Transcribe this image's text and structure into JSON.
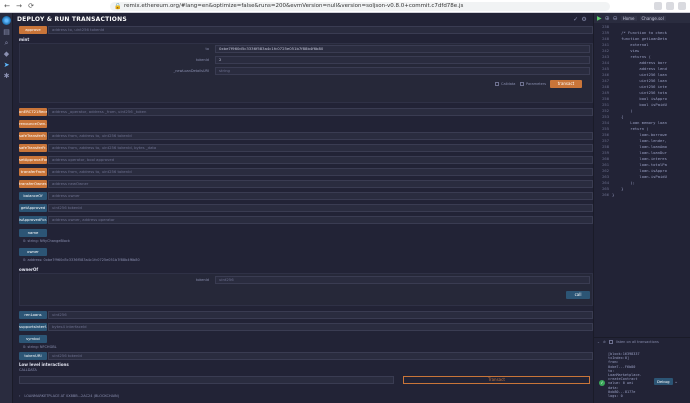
{
  "browser": {
    "url": "remix.ethereum.org/#lang=en&optimize=false&runs=200&evmVersion=null&version=soljson-v0.8.0+commit.c7dfd78e.js",
    "nav": [
      "←",
      "→",
      "⟳"
    ],
    "lock": "🔒"
  },
  "panel": {
    "title": "DEPLOY & RUN TRANSACTIONS",
    "icons": [
      "✓",
      "⚙"
    ]
  },
  "top_fn": {
    "label": "approve",
    "placeholder": "address to, uint256 tokenId"
  },
  "mint_section": {
    "title": "mint",
    "fields": [
      {
        "label": "to",
        "value": "0xbe7f960d5c3336f583a4c1fc0725e051b7f88b4f6b80"
      },
      {
        "label": "tokenId",
        "value": "2"
      },
      {
        "label": "_newLoanDetailsURI",
        "value": "string"
      }
    ],
    "calldata_label": "Calldata",
    "parameters_label": "Parameters",
    "transact_label": "transact"
  },
  "write_functions": [
    {
      "label": "onERC721Recei...",
      "placeholder": "address _operator, address _from, uint256 _token",
      "color": "orange"
    },
    {
      "label": "renounceOwn...",
      "placeholder": "",
      "color": "orange"
    },
    {
      "label": "safeTransferFr...",
      "placeholder": "address from, address to, uint256 tokenId",
      "color": "orange"
    },
    {
      "label": "safeTransferFr...",
      "placeholder": "address from, address to, uint256 tokenId, bytes _data",
      "color": "orange"
    },
    {
      "label": "setApprovalFor...",
      "placeholder": "address operator, bool approved",
      "color": "orange"
    },
    {
      "label": "transferFrom",
      "placeholder": "address from, address to, uint256 tokenId",
      "color": "orange"
    },
    {
      "label": "transferOwner...",
      "placeholder": "address newOwner",
      "color": "orange"
    }
  ],
  "read_functions": [
    {
      "label": "balanceOf",
      "placeholder": "address owner"
    },
    {
      "label": "getApproved",
      "placeholder": "uint256 tokenId"
    },
    {
      "label": "isApprovedFor...",
      "placeholder": "address owner, address operator"
    }
  ],
  "name_fn": {
    "label": "name",
    "result": "0:   string: NftyChangeBlock"
  },
  "owner_fn": {
    "label": "owner",
    "result": "0:   address: 0xbe7f960d5c3336f583a4c1fc0725e051b7f88b4f6b80"
  },
  "ownerOf_section": {
    "title": "ownerOf",
    "field_label": "tokenId",
    "field_placeholder": "uint256",
    "call_label": "call"
  },
  "more_read": [
    {
      "label": "renLoans",
      "placeholder": "uint256"
    },
    {
      "label": "supportsInterf...",
      "placeholder": "bytes4 interfaceId"
    }
  ],
  "symbol_fn": {
    "label": "symbol",
    "result": "0:   string: NFCHGBL"
  },
  "tokenURI_fn": {
    "label": "tokenURI",
    "placeholder": "uint256 tokenId"
  },
  "low_level": {
    "title": "Low level interactions",
    "calldata": "CALLDATA",
    "transact_label": "Transact"
  },
  "footer": {
    "chevron": "›",
    "contract_line": "LOANMARKETPLACE AT 0X8BB...2AC24 (BLOCKCHAIN)"
  },
  "editor": {
    "home_tab": "Home",
    "file_tab": "Change.sol",
    "lines": [
      {
        "n": "238",
        "code": ""
      },
      {
        "n": "239",
        "code": "    /* Function to check"
      },
      {
        "n": "240",
        "code": "    function getLoanDeta"
      },
      {
        "n": "241",
        "code": "        external"
      },
      {
        "n": "242",
        "code": "        view"
      },
      {
        "n": "243",
        "code": "        returns ("
      },
      {
        "n": "244",
        "code": "            address borr"
      },
      {
        "n": "245",
        "code": "            address lend"
      },
      {
        "n": "246",
        "code": "            uint256 loan"
      },
      {
        "n": "247",
        "code": "            uint256 loan"
      },
      {
        "n": "248",
        "code": "            uint256 inte"
      },
      {
        "n": "249",
        "code": "            uint256 tota"
      },
      {
        "n": "250",
        "code": "            bool isAppro"
      },
      {
        "n": "251",
        "code": "            bool isPaidU"
      },
      {
        "n": "252",
        "code": "        )"
      },
      {
        "n": "253",
        "code": "    {"
      },
      {
        "n": "254",
        "code": "        Loan memory loan"
      },
      {
        "n": "255",
        "code": "        return ("
      },
      {
        "n": "256",
        "code": "            loan.borrowe"
      },
      {
        "n": "257",
        "code": "            loan.lender,"
      },
      {
        "n": "258",
        "code": "            loan.loanAmo"
      },
      {
        "n": "259",
        "code": "            loan.loanDur"
      },
      {
        "n": "260",
        "code": "            loan.interes"
      },
      {
        "n": "261",
        "code": "            loan.totalPa"
      },
      {
        "n": "262",
        "code": "            loan.isAppro"
      },
      {
        "n": "263",
        "code": "            loan.isPaidU"
      },
      {
        "n": "264",
        "code": "        );"
      },
      {
        "n": "265",
        "code": "    }"
      },
      {
        "n": "266",
        "code": "}"
      }
    ]
  },
  "terminal": {
    "listen_label": "listen on all transactions",
    "log": "[block:16398337\ntxIndex:0]\nfrom:\n0xbe7...F6b80\nto:\nLoanMarketplace.\ncreateContract\nvalue: 0 wei\ndata:\n0xb80...8177e\nlogs: 0",
    "debug_label": "Debug",
    "check": "✓",
    "caret": "⌄"
  }
}
